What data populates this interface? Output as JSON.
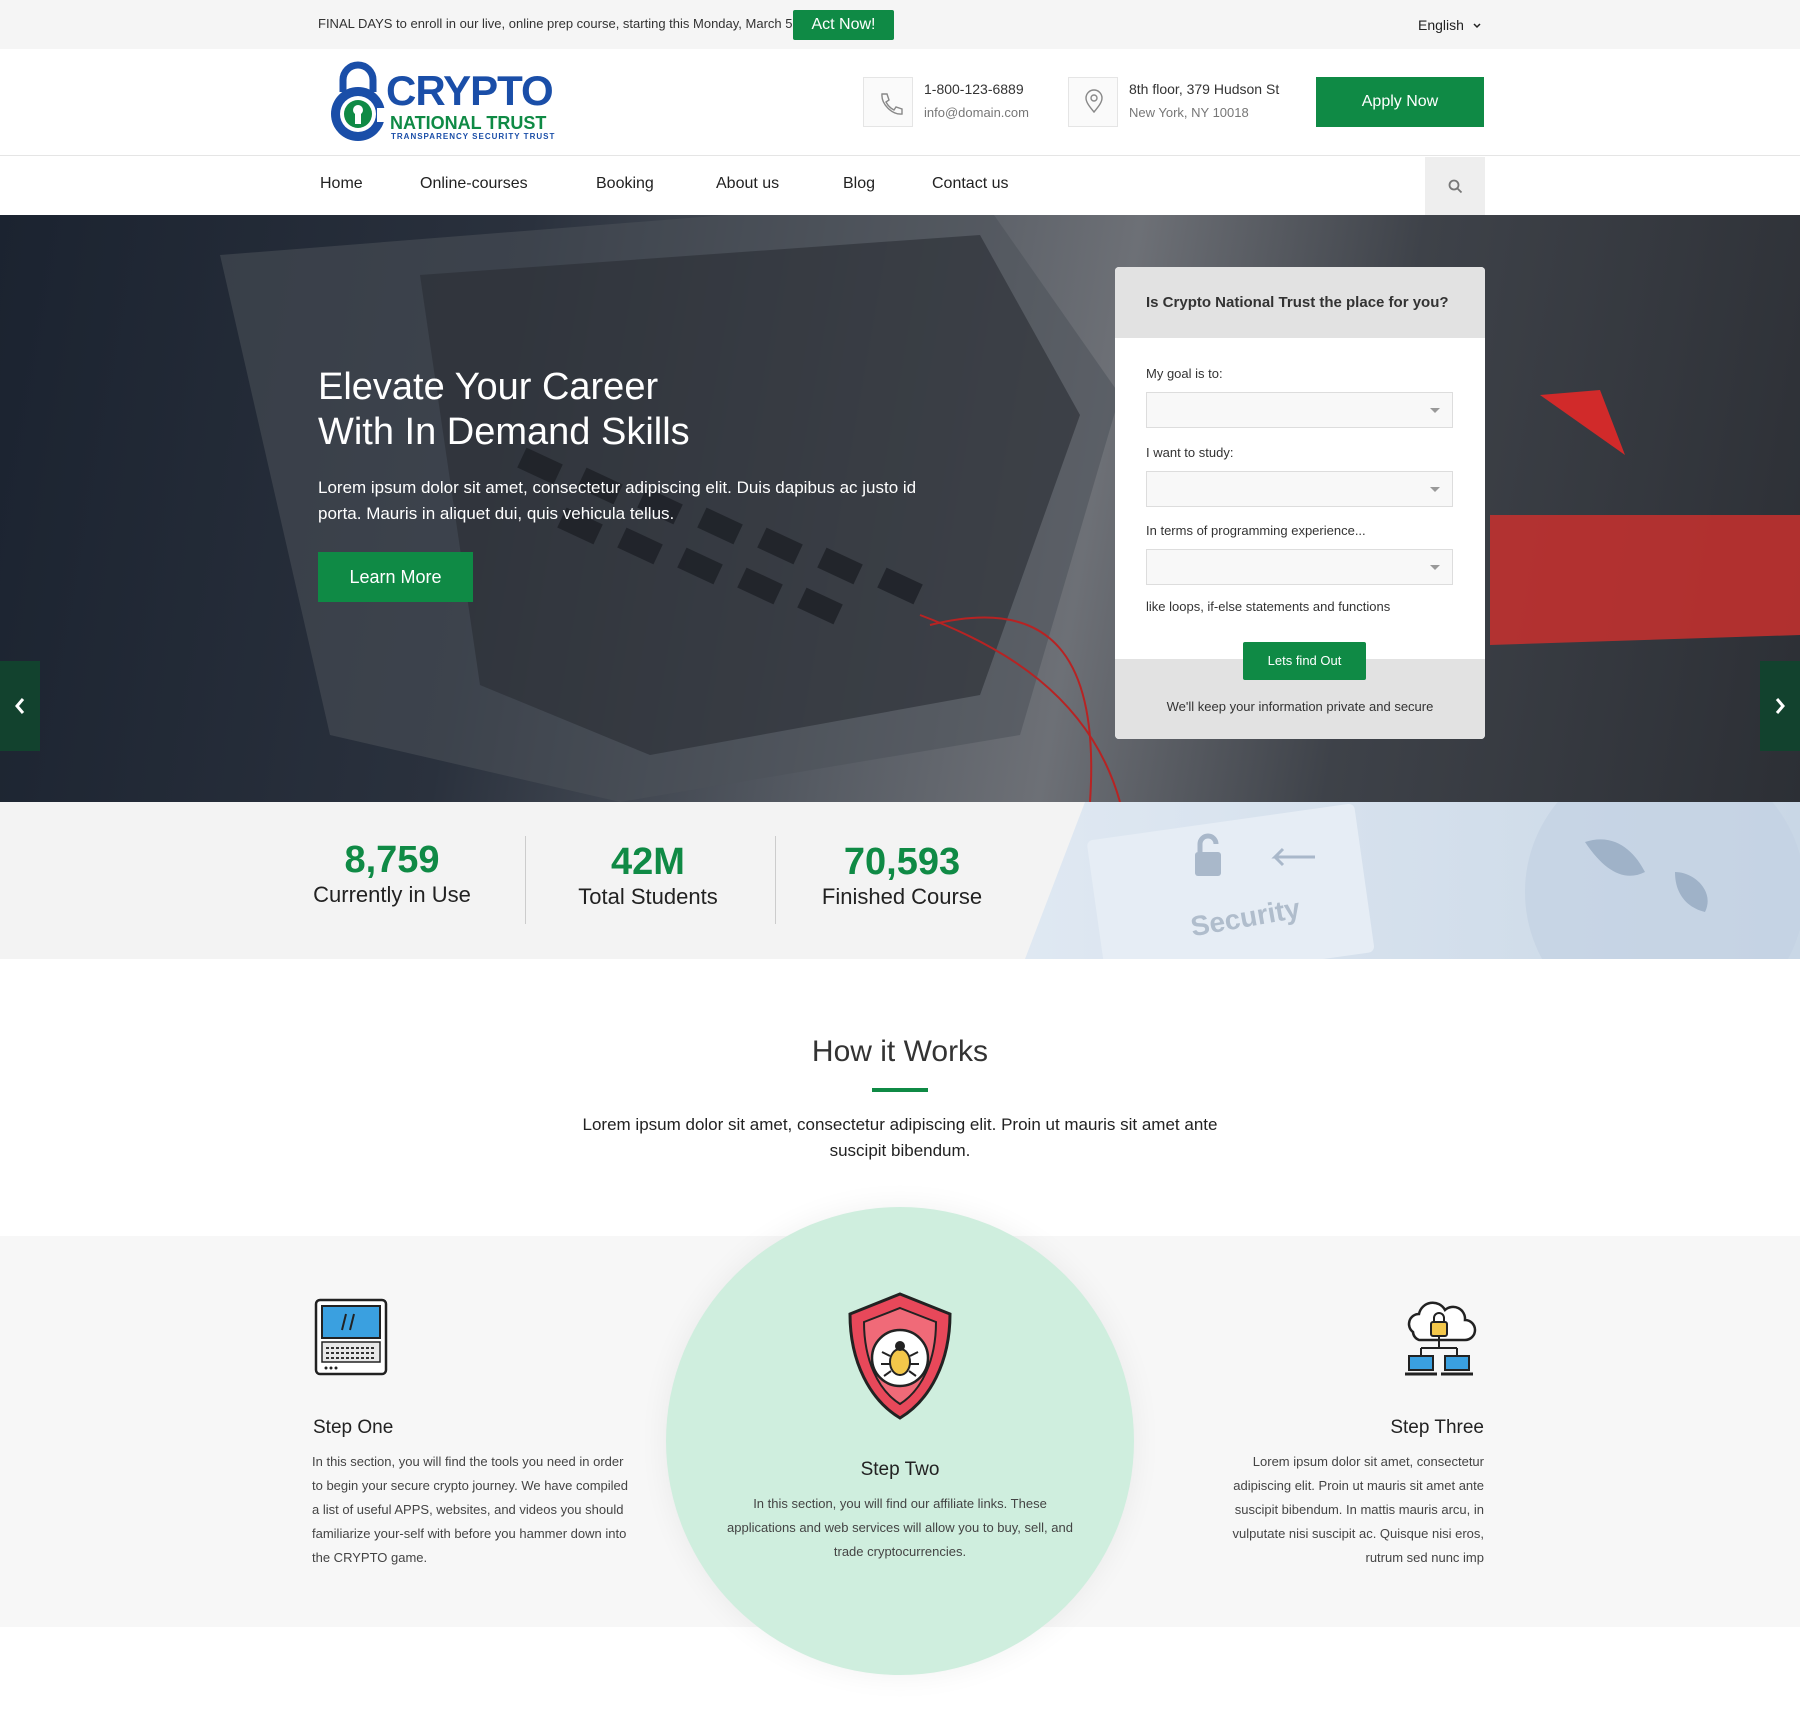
{
  "topbar": {
    "promo": "FINAL DAYS to enroll in our live, online prep course, starting this Monday, March 5.",
    "cta": "Act Now!",
    "language": "English"
  },
  "header": {
    "logo": {
      "line1": "CRYPTO",
      "line2": "NATIONAL TRUST",
      "line3": "TRANSPARENCY SECURITY TRUST"
    },
    "phone": "1-800-123-6889",
    "email": "info@domain.com",
    "address1": "8th floor, 379 Hudson St",
    "address2": "New York, NY 10018",
    "apply": "Apply Now"
  },
  "nav": {
    "items": [
      "Home",
      "Online-courses",
      "Booking",
      "About us",
      "Blog",
      "Contact us"
    ]
  },
  "hero": {
    "title1": "Elevate Your Career",
    "title2": "With In Demand Skills",
    "text": "Lorem ipsum dolor sit amet, consectetur adipiscing elit. Duis dapibus ac justo id porta. Mauris in aliquet dui, quis vehicula tellus.",
    "button": "Learn More"
  },
  "form": {
    "title": "Is Crypto National Trust the place for you?",
    "goal_label": "My goal is to:",
    "study_label": "I want to study:",
    "experience_label": "In terms of programming experience...",
    "hint": "like loops, if-else statements and functions",
    "button": "Lets find Out",
    "note": "We'll keep your information private and secure"
  },
  "stats": [
    {
      "value": "8,759",
      "label": "Currently in Use"
    },
    {
      "value": "42M",
      "label": "Total Students"
    },
    {
      "value": "70,593",
      "label": "Finished Course"
    }
  ],
  "stats_bg_text": "Security",
  "how": {
    "title": "How it Works",
    "text": "Lorem ipsum dolor sit amet, consectetur adipiscing elit. Proin ut mauris sit amet ante suscipit bibendum."
  },
  "steps": [
    {
      "title": "Step One",
      "text": "In this section, you will find the tools you need in order to begin your secure crypto journey. We have compiled a list of useful APPS, websites, and videos you should familiarize your-self with before you hammer down into the CRYPTO game."
    },
    {
      "title": "Step Two",
      "text": "In this section, you will find our affiliate links. These applications and web services will allow you to buy, sell, and trade cryptocurrencies."
    },
    {
      "title": "Step Three",
      "text": "Lorem ipsum dolor sit amet, consectetur adipiscing elit. Proin ut mauris sit amet ante suscipit bibendum. In mattis mauris arcu, in vulputate nisi suscipit ac. Quisque nisi eros, rutrum sed nunc imp"
    }
  ],
  "colors": {
    "accent": "#0f8a45",
    "brand_blue": "#1a4ea8",
    "circle": "#cfeede"
  },
  "icons": [
    "phone-icon",
    "map-pin-icon",
    "search-icon",
    "chevron-left-icon",
    "chevron-right-icon",
    "laptop-icon",
    "shield-bug-icon",
    "cloud-network-icon"
  ]
}
